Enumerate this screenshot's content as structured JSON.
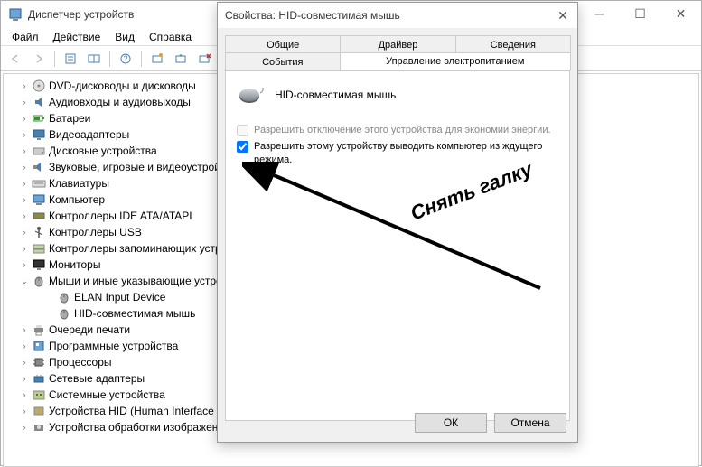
{
  "dm": {
    "title": "Диспетчер устройств",
    "menu": {
      "file": "Файл",
      "action": "Действие",
      "view": "Вид",
      "help": "Справка"
    },
    "tree": [
      {
        "label": "DVD-дисководы и дисководы",
        "expand": ">",
        "icon": "disc"
      },
      {
        "label": "Аудиовходы и аудиовыходы",
        "expand": ">",
        "icon": "audio"
      },
      {
        "label": "Батареи",
        "expand": ">",
        "icon": "battery"
      },
      {
        "label": "Видеоадаптеры",
        "expand": ">",
        "icon": "display"
      },
      {
        "label": "Дисковые устройства",
        "expand": ">",
        "icon": "drive"
      },
      {
        "label": "Звуковые, игровые и видеоустройства",
        "expand": ">",
        "icon": "sound"
      },
      {
        "label": "Клавиатуры",
        "expand": ">",
        "icon": "keyboard"
      },
      {
        "label": "Компьютер",
        "expand": ">",
        "icon": "computer"
      },
      {
        "label": "Контроллеры IDE ATA/ATAPI",
        "expand": ">",
        "icon": "ide"
      },
      {
        "label": "Контроллеры USB",
        "expand": ">",
        "icon": "usb"
      },
      {
        "label": "Контроллеры запоминающих устройств",
        "expand": ">",
        "icon": "storage"
      },
      {
        "label": "Мониторы",
        "expand": ">",
        "icon": "monitor"
      },
      {
        "label": "Мыши и иные указывающие устройства",
        "expand": "v",
        "icon": "mouse"
      },
      {
        "label": "Очереди печати",
        "expand": ">",
        "icon": "printer"
      },
      {
        "label": "Программные устройства",
        "expand": ">",
        "icon": "software"
      },
      {
        "label": "Процессоры",
        "expand": ">",
        "icon": "cpu"
      },
      {
        "label": "Сетевые адаптеры",
        "expand": ">",
        "icon": "network"
      },
      {
        "label": "Системные устройства",
        "expand": ">",
        "icon": "system"
      },
      {
        "label": "Устройства HID (Human Interface Devices)",
        "expand": ">",
        "icon": "hid"
      },
      {
        "label": "Устройства обработки изображений",
        "expand": ">",
        "icon": "imaging"
      }
    ],
    "children": [
      {
        "label": "ELAN Input Device",
        "icon": "mouse"
      },
      {
        "label": "HID-совместимая мышь",
        "icon": "mouse"
      }
    ]
  },
  "dlg": {
    "title": "Свойства: HID-совместимая мышь",
    "tabs": {
      "general": "Общие",
      "driver": "Драйвер",
      "details": "Сведения",
      "events": "События",
      "power": "Управление электропитанием"
    },
    "device_name": "HID-совместимая мышь",
    "chk1": "Разрешить отключение этого устройства для экономии энергии.",
    "chk2": "Разрешить этому устройству выводить компьютер из ждущего режима.",
    "ok": "ОК",
    "cancel": "Отмена"
  },
  "annotation": "Снять галку"
}
